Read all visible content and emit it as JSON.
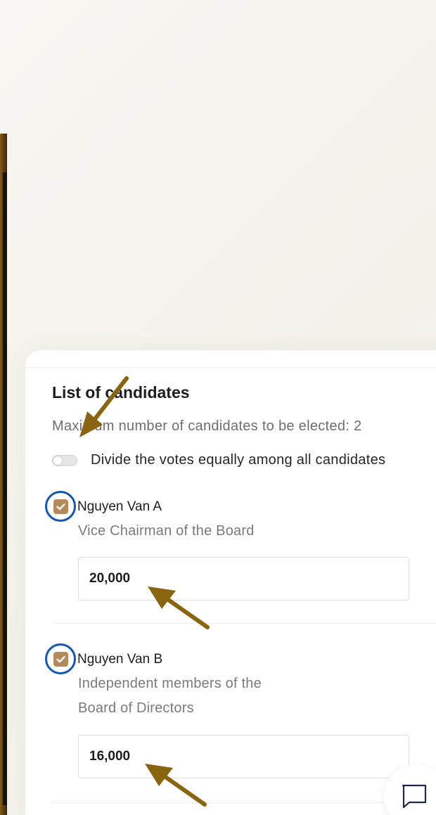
{
  "candidates_panel": {
    "title": "List of candidates",
    "max_text": "Maximum number of candidates to be elected: 2",
    "divide_toggle": {
      "label": "Divide the votes equally among all candidates",
      "on": false
    },
    "candidates": [
      {
        "name": "Nguyen Van A",
        "role_lines": [
          "Vice Chairman of the Board"
        ],
        "checked": true,
        "votes": "20,000"
      },
      {
        "name": "Nguyen Van B",
        "role_lines": [
          "Independent members of the",
          "Board of Directors"
        ],
        "checked": true,
        "votes": "16,000"
      }
    ]
  },
  "chat": {
    "icon": "chat-bubble-icon"
  },
  "colors": {
    "checkbox": "#b58a5a",
    "annotation_arrow": "#8a6510",
    "annotation_ring": "#1456b8",
    "phone_frame": "#c99a3b"
  }
}
